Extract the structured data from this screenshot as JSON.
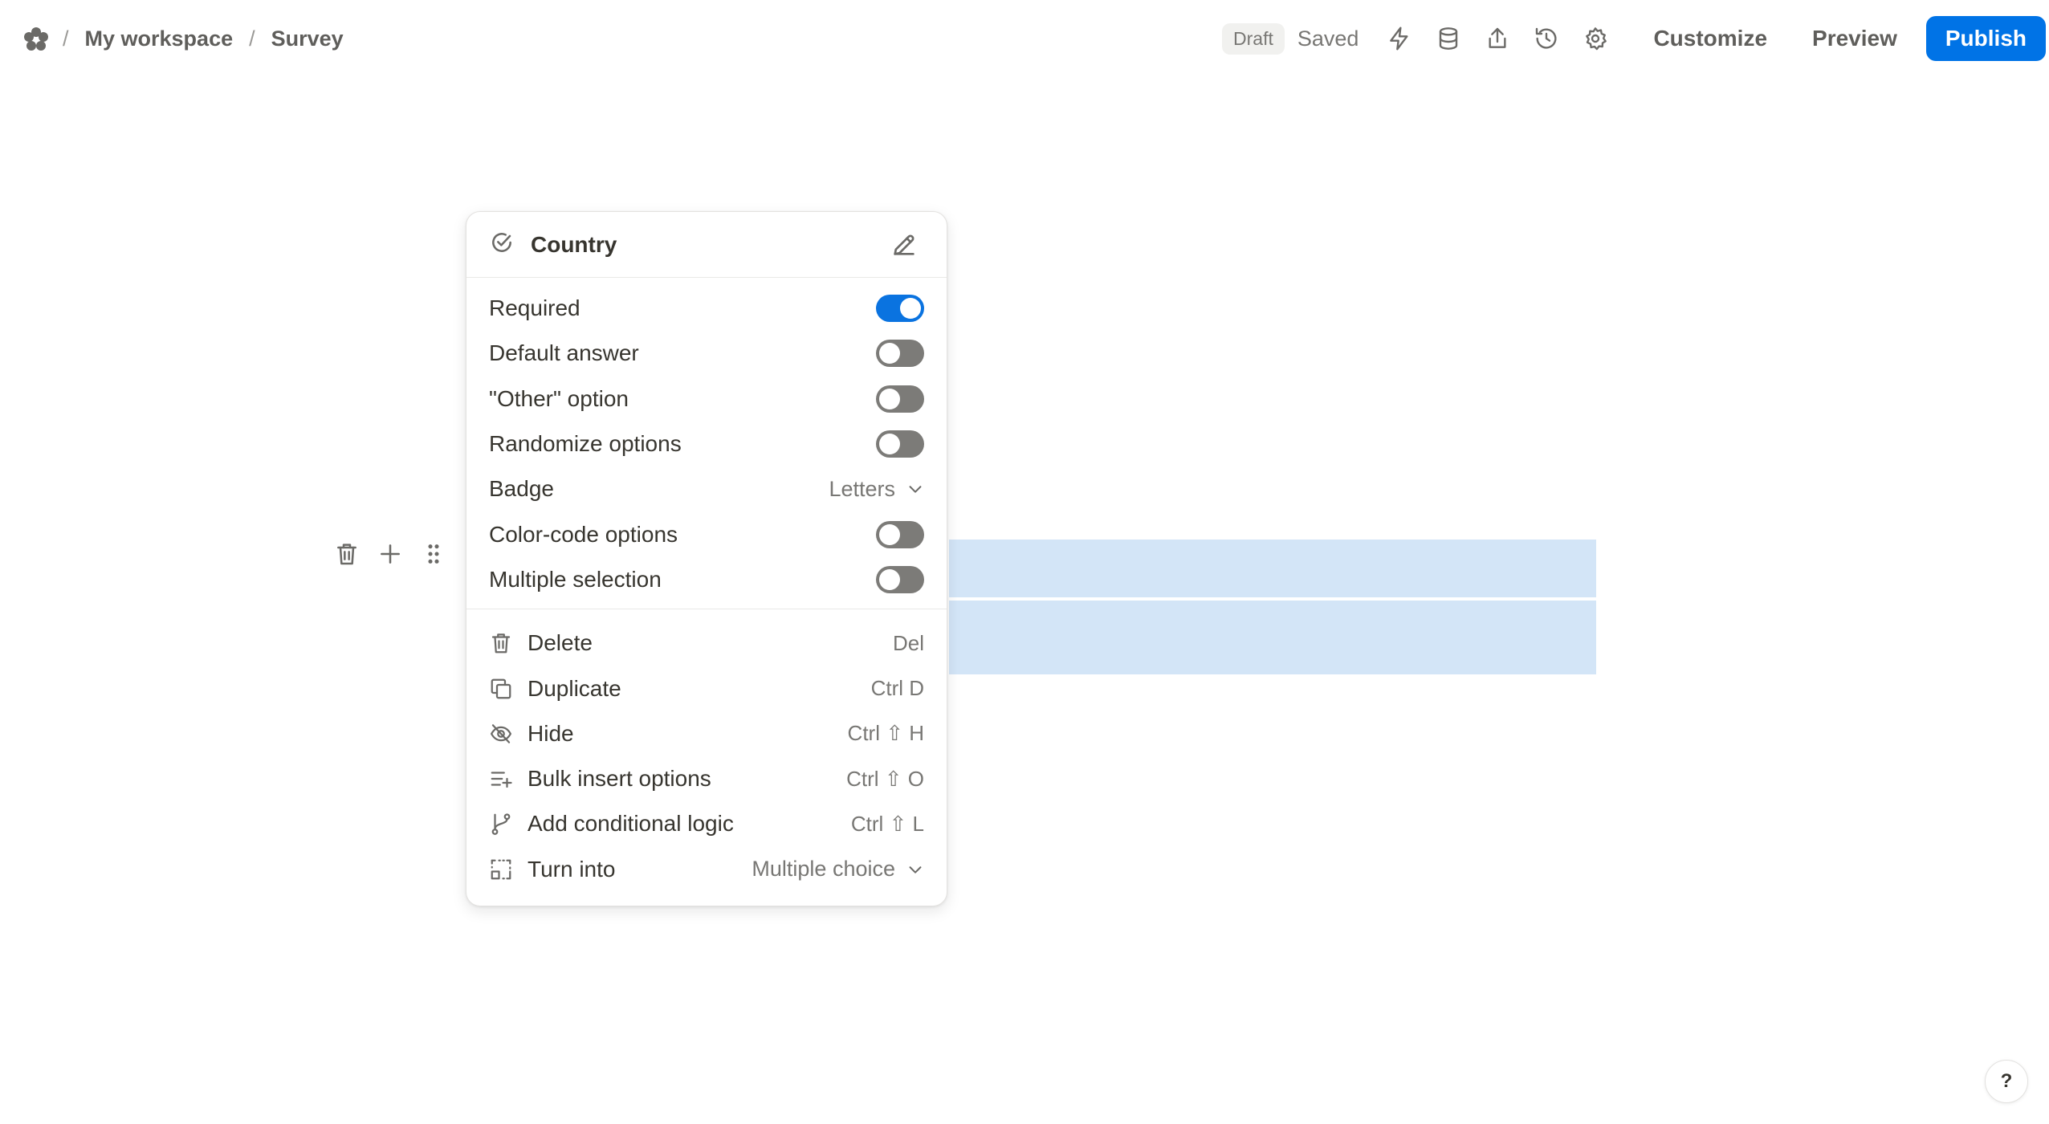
{
  "breadcrumb": {
    "workspace": "My workspace",
    "page": "Survey",
    "separator": "/"
  },
  "header": {
    "status_badge": "Draft",
    "save_status": "Saved",
    "icons": [
      "lightning-icon",
      "database-icon",
      "share-icon",
      "history-icon",
      "settings-gear-icon"
    ],
    "customize_label": "Customize",
    "preview_label": "Preview",
    "publish_label": "Publish"
  },
  "menu": {
    "title": "Country",
    "settings": [
      {
        "label": "Required",
        "type": "toggle",
        "on": true
      },
      {
        "label": "Default answer",
        "type": "toggle",
        "on": false
      },
      {
        "label": "\"Other\" option",
        "type": "toggle",
        "on": false
      },
      {
        "label": "Randomize options",
        "type": "toggle",
        "on": false
      },
      {
        "label": "Badge",
        "type": "select",
        "value": "Letters"
      },
      {
        "label": "Color-code options",
        "type": "toggle",
        "on": false
      },
      {
        "label": "Multiple selection",
        "type": "toggle",
        "on": false
      }
    ],
    "actions": [
      {
        "label": "Delete",
        "shortcut": "Del",
        "icon": "trash-icon"
      },
      {
        "label": "Duplicate",
        "shortcut": "Ctrl D",
        "icon": "duplicate-icon"
      },
      {
        "label": "Hide",
        "shortcut": "Ctrl ⇧ H",
        "icon": "eye-off-icon"
      },
      {
        "label": "Bulk insert options",
        "shortcut": "Ctrl ⇧ O",
        "icon": "bulk-insert-icon"
      },
      {
        "label": "Add conditional logic",
        "shortcut": "Ctrl ⇧ L",
        "icon": "branch-icon"
      },
      {
        "label": "Turn into",
        "value": "Multiple choice",
        "icon": "turn-into-icon"
      }
    ]
  },
  "help": {
    "label": "?"
  },
  "colors": {
    "accent": "#0073e6",
    "highlight": "#d3e5f7",
    "toggle_off": "#7c7b78"
  }
}
